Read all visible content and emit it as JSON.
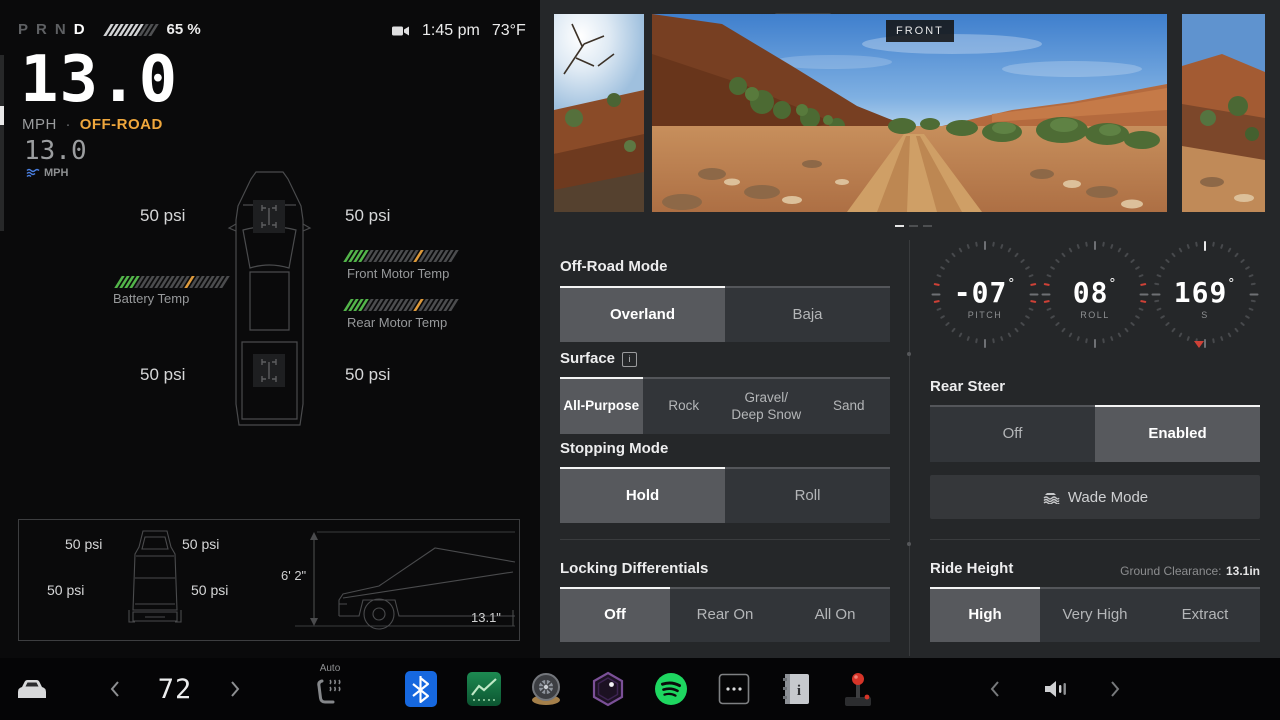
{
  "status_bar": {
    "gears": {
      "p": "P",
      "r": "R",
      "n": "N",
      "d": "D"
    },
    "selected_gear": "D",
    "battery_percent": "65 %",
    "time": "1:45 pm",
    "outside_temp": "73°F"
  },
  "speed": {
    "value": "13.0",
    "unit": "MPH",
    "separator": "·",
    "drive_mode": "OFF-ROAD",
    "secondary_value": "13.0",
    "secondary_unit": "MPH"
  },
  "tire_pressure": {
    "front_left": "50 psi",
    "front_right": "50 psi",
    "rear_left": "50 psi",
    "rear_right": "50 psi"
  },
  "temps": {
    "battery_label": "Battery Temp",
    "front_motor_label": "Front Motor Temp",
    "rear_motor_label": "Rear Motor Temp"
  },
  "dimension_box": {
    "front_left_psi": "50 psi",
    "front_right_psi": "50 psi",
    "rear_left_psi": "50 psi",
    "rear_right_psi": "50 psi",
    "vehicle_height": "6' 2\"",
    "ground_clearance": "13.1\""
  },
  "camera": {
    "front_label": "FRONT"
  },
  "controls": {
    "offroad_mode": {
      "title": "Off-Road Mode",
      "selected": "Overland",
      "options": [
        {
          "label": "Overland"
        },
        {
          "label": "Baja"
        }
      ]
    },
    "surface": {
      "title": "Surface",
      "info_icon": "i",
      "selected": "All-Purpose",
      "options": [
        {
          "label": "All-Purpose"
        },
        {
          "label": "Rock"
        },
        {
          "label": "Gravel/",
          "label2": "Deep Snow"
        },
        {
          "label": "Sand"
        }
      ]
    },
    "stopping_mode": {
      "title": "Stopping Mode",
      "selected": "Hold",
      "options": [
        {
          "label": "Hold"
        },
        {
          "label": "Roll"
        }
      ]
    },
    "locking_differentials": {
      "title": "Locking Differentials",
      "selected": "Off",
      "options": [
        {
          "label": "Off"
        },
        {
          "label": "Rear On"
        },
        {
          "label": "All On"
        }
      ]
    },
    "rear_steer": {
      "title": "Rear Steer",
      "selected": "Enabled",
      "options": [
        {
          "label": "Off"
        },
        {
          "label": "Enabled"
        }
      ]
    },
    "wade_mode": {
      "label": "Wade Mode"
    },
    "ride_height": {
      "title": "Ride Height",
      "clearance_label": "Ground Clearance:",
      "clearance_value": "13.1in",
      "selected": "High",
      "options": [
        {
          "label": "High"
        },
        {
          "label": "Very High"
        },
        {
          "label": "Extract"
        }
      ]
    }
  },
  "gauges": {
    "pitch": {
      "value": "-07",
      "degree": "°",
      "label": "PITCH"
    },
    "roll": {
      "value": "08",
      "degree": "°",
      "label": "ROLL"
    },
    "heading": {
      "value": "169",
      "degree": "°",
      "label": "S"
    }
  },
  "bottom_bar": {
    "cabin_temp": "72",
    "seat_heater_label": "Auto"
  },
  "colors": {
    "accent_orange": "#EFA73C",
    "temp_green": "#53B54A",
    "temp_warn_orange": "#DE9A3B",
    "gauge_red": "#CE4137",
    "bluetooth_blue": "#1668DF",
    "spotify_green": "#1ED760",
    "panel_bg": "#252729",
    "selected_segment": "#57595D"
  }
}
